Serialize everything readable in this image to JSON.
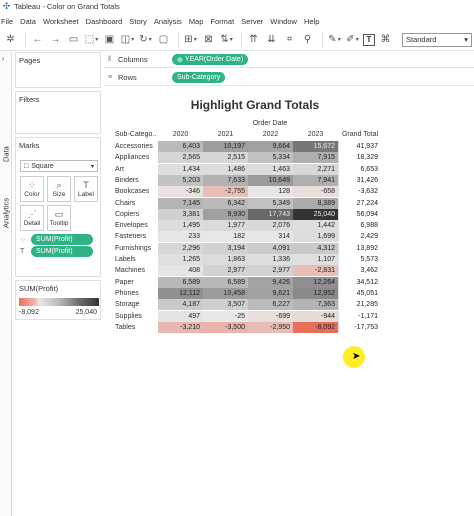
{
  "window": {
    "title": "Tableau - Color on Grand Totals"
  },
  "menu": [
    "File",
    "Data",
    "Worksheet",
    "Dashboard",
    "Story",
    "Analysis",
    "Map",
    "Format",
    "Server",
    "Window",
    "Help"
  ],
  "toolbar": {
    "fit": "Standard"
  },
  "sidetabs": {
    "data": "Data",
    "analytics": "Analytics"
  },
  "panes": {
    "pages": "Pages",
    "filters": "Filters",
    "marks": "Marks"
  },
  "marks": {
    "type": "Square",
    "cards": [
      "Color",
      "Size",
      "Label",
      "Detail",
      "Tooltip"
    ],
    "pills": [
      "SUM(Profit)",
      "SUM(Profit)"
    ]
  },
  "legend": {
    "title": "SUM(Profit)",
    "min": "-8,092",
    "max": "25,040"
  },
  "shelves": {
    "columns_label": "Columns",
    "columns_pill": "YEAR(Order Date)",
    "rows_label": "Rows",
    "rows_pill": "Sub-Category"
  },
  "viz": {
    "title": "Highlight Grand Totals",
    "col_group": "Order Date",
    "row_header": "Sub-Catego..",
    "years": [
      "2020",
      "2021",
      "2022",
      "2023"
    ],
    "gt_header": "Grand Total"
  },
  "chart_data": {
    "type": "heatmap",
    "title": "Highlight Grand Totals",
    "x_label": "Order Date",
    "x": [
      "2020",
      "2021",
      "2022",
      "2023",
      "Grand Total"
    ],
    "y": [
      "Accessories",
      "Appliances",
      "Art",
      "Binders",
      "Bookcases",
      "Chairs",
      "Copiers",
      "Envelopes",
      "Fasteners",
      "Furnishings",
      "Labels",
      "Machines",
      "Paper",
      "Phones",
      "Storage",
      "Supplies",
      "Tables"
    ],
    "values": [
      [
        6403,
        10197,
        9664,
        15672,
        41937
      ],
      [
        2565,
        2515,
        5334,
        7915,
        18329
      ],
      [
        1434,
        1486,
        1463,
        2271,
        6653
      ],
      [
        5203,
        7633,
        10649,
        7941,
        31426
      ],
      [
        -346,
        -2755,
        128,
        -658,
        -3632
      ],
      [
        7145,
        6342,
        5349,
        8389,
        27224
      ],
      [
        3381,
        9930,
        17743,
        25040,
        56094
      ],
      [
        1495,
        1977,
        2076,
        1442,
        6988
      ],
      [
        233,
        182,
        314,
        1699,
        2429
      ],
      [
        2296,
        3194,
        4091,
        4312,
        13892
      ],
      [
        1265,
        1863,
        1336,
        1107,
        5573
      ],
      [
        408,
        2977,
        2977,
        -2831,
        3462
      ],
      [
        6589,
        6589,
        9426,
        12264,
        34512
      ],
      [
        12112,
        10458,
        9621,
        12952,
        45051
      ],
      [
        4187,
        3507,
        6227,
        7363,
        21285
      ],
      [
        497,
        -25,
        -699,
        -944,
        -1171
      ],
      [
        -3210,
        -3500,
        -2950,
        -8092,
        -17753
      ]
    ],
    "display": [
      [
        "6,403",
        "10,197",
        "9,664",
        "15,672",
        "41,937"
      ],
      [
        "2,565",
        "2,515",
        "5,334",
        "7,915",
        "18,329"
      ],
      [
        "1,434",
        "1,486",
        "1,463",
        "2,271",
        "6,653"
      ],
      [
        "5,203",
        "7,633",
        "10,649",
        "7,941",
        "31,426"
      ],
      [
        "-346",
        "-2,755",
        "128",
        "-658",
        "-3,632"
      ],
      [
        "7,145",
        "6,342",
        "5,349",
        "8,389",
        "27,224"
      ],
      [
        "3,381",
        "9,930",
        "17,743",
        "25,040",
        "56,094"
      ],
      [
        "1,495",
        "1,977",
        "2,076",
        "1,442",
        "6,988"
      ],
      [
        "233",
        "182",
        "314",
        "1,699",
        "2,429"
      ],
      [
        "2,296",
        "3,194",
        "4,091",
        "4,312",
        "13,892"
      ],
      [
        "1,265",
        "1,863",
        "1,336",
        "1,107",
        "5,573"
      ],
      [
        "408",
        "2,977",
        "2,977",
        "-2,831",
        "3,462"
      ],
      [
        "6,589",
        "6,589",
        "9,426",
        "12,264",
        "34,512"
      ],
      [
        "12,112",
        "10,458",
        "9,621",
        "12,952",
        "45,051"
      ],
      [
        "4,187",
        "3,507",
        "6,227",
        "7,363",
        "21,285"
      ],
      [
        "497",
        "-25",
        "-699",
        "-944",
        "-1,171"
      ],
      [
        "-3,210",
        "-3,500",
        "-2,950",
        "-8,092",
        "-17,753"
      ]
    ],
    "color_range": [
      -8092,
      25040
    ],
    "colors": {
      "negative": "#e8705a",
      "zero": "#e8e8e8",
      "positive_max": "#333333"
    }
  }
}
